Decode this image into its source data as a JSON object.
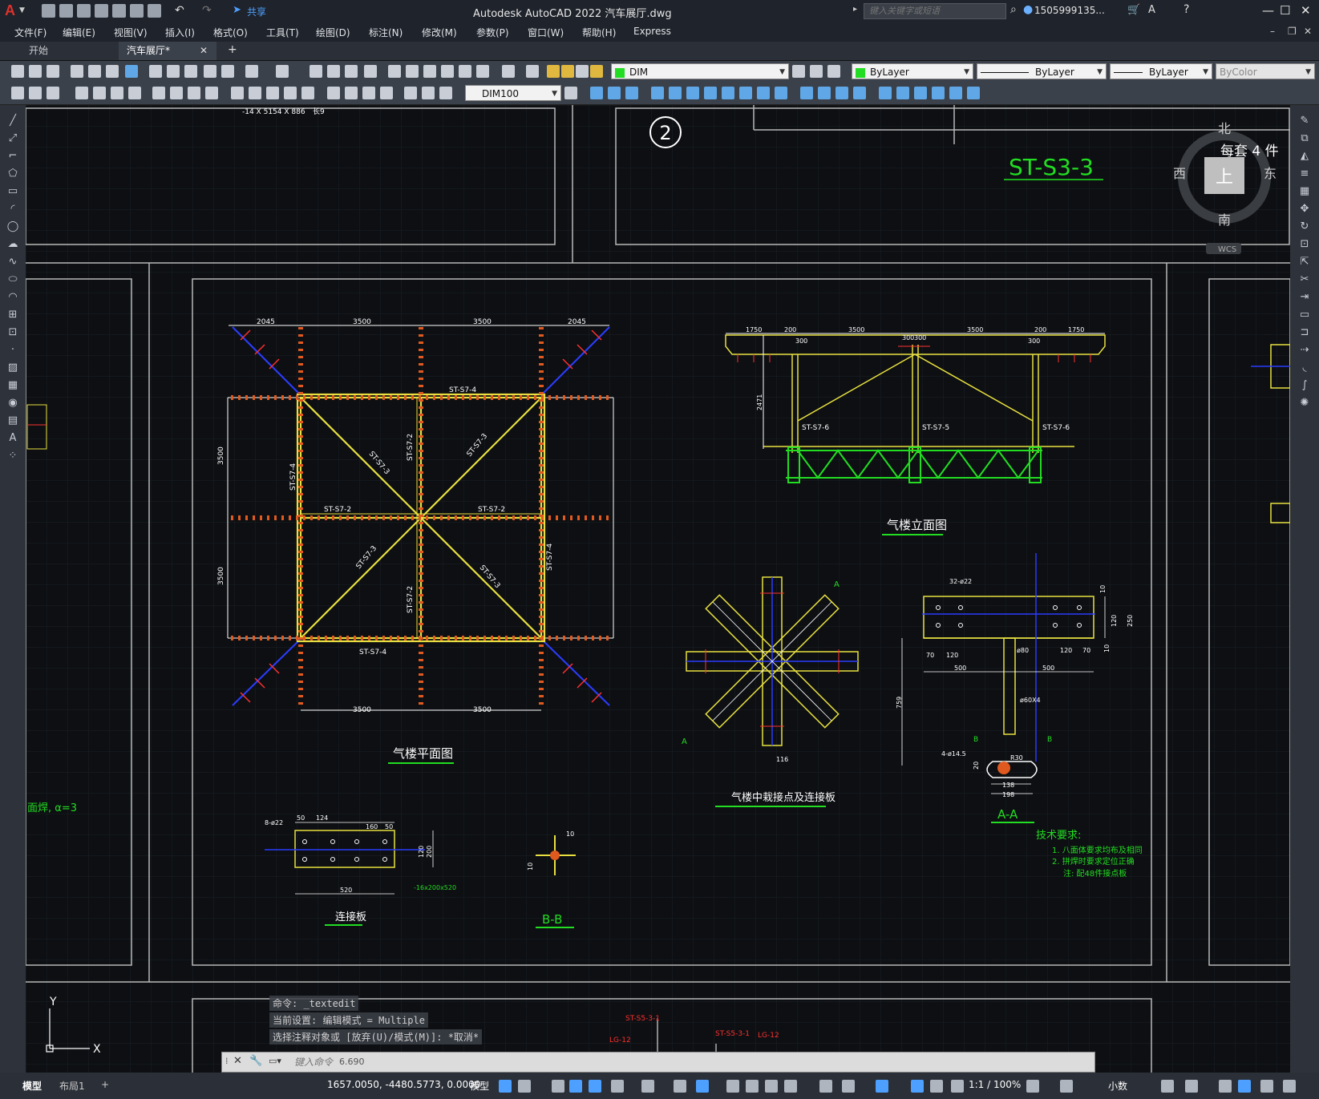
{
  "app": {
    "title": "Autodesk AutoCAD 2022    汽车展厅.dwg",
    "logo": "A",
    "share_label": "共享",
    "search_placeholder": "键入关键字或短语",
    "user": "1505999135...",
    "window_controls": [
      "minimize-icon",
      "maximize-icon",
      "close-icon"
    ]
  },
  "menubar": {
    "items": [
      "文件(F)",
      "编辑(E)",
      "视图(V)",
      "插入(I)",
      "格式(O)",
      "工具(T)",
      "绘图(D)",
      "标注(N)",
      "修改(M)",
      "参数(P)",
      "窗口(W)",
      "帮助(H)",
      "Express"
    ]
  },
  "tabs": {
    "start": "开始",
    "active": "汽车展厅*",
    "close": "✕",
    "add": "+"
  },
  "toolbar": {
    "layer": "DIM",
    "color": "ByLayer",
    "linetype": "ByLayer",
    "lineweight": "ByLayer",
    "plotstyle": "ByColor",
    "dimstyle": "DIM100"
  },
  "viewcube": {
    "north": "北",
    "south": "南",
    "east": "东",
    "west": "西",
    "top": "上",
    "wcs": "WCS",
    "note": "每套 4 件"
  },
  "drawing": {
    "sheet_number": "2",
    "sheet_title": "ST-S3-3",
    "plan_title": "气楼平面图",
    "elevation_title": "气楼立面图",
    "joint_title": "气楼中栽接点及连接板",
    "plate_title": "连接板",
    "section_bb": "B-B",
    "section_aa": "A-A",
    "tech_title": "技术要求:",
    "tech_notes": [
      "1. 八面体要求均布及相同",
      "2. 拼焊时要求定位正确",
      "注: 配48件接点板"
    ],
    "top_dim": "-14 X 5154 X 886",
    "top_dim2": "长9",
    "side_note": "面焊, α=3",
    "plan_dims_top": [
      "2045",
      "3500",
      "3500",
      "2045"
    ],
    "plan_dims_bottom": [
      "3500",
      "3500"
    ],
    "plan_dims_side": [
      "3500",
      "3500"
    ],
    "plan_members": [
      "ST-S7-4",
      "ST-S7-2",
      "ST-S7-3",
      "ST-S7-2",
      "ST-S7-2",
      "ST-S7-3",
      "ST-S7-4",
      "ST-S7-3",
      "ST-S7-2",
      "ST-S7-3",
      "ST-S7-4",
      "ST-S7-4"
    ],
    "elev_dims": [
      "1750",
      "200",
      "3500",
      "300",
      "300",
      "3500",
      "200",
      "1750",
      "300",
      "300"
    ],
    "elev_members": [
      "ST-S7-6",
      "ST-S7-5",
      "ST-S7-6"
    ],
    "elev_height": "2471",
    "aa_dims": [
      "32-ø22",
      "70",
      "120",
      "ø80",
      "120",
      "70",
      "500",
      "500",
      "ø60X4",
      "759",
      "4-ø14.5",
      "R30",
      "138",
      "198",
      "250",
      "120",
      "10",
      "10",
      "20"
    ],
    "plate_dims": [
      "8-ø22",
      "50",
      "124",
      "160",
      "50",
      "520",
      "200",
      "120",
      "-16x200x520"
    ],
    "bb_dims": [
      "10",
      "10"
    ],
    "labels_bottom": [
      "ST-S5-3-1",
      "LG-12",
      "ST-S5-3-1",
      "LG-12"
    ]
  },
  "command": {
    "history": [
      "命令: _textedit",
      "当前设置: 编辑模式 = Multiple",
      "选择注释对象或 [放弃(U)/模式(M)]: *取消*"
    ],
    "placeholder": "键入命令",
    "value_hint": "6.690"
  },
  "ucs": {
    "x": "X",
    "y": "Y"
  },
  "status": {
    "model_tab": "模型",
    "layout_tab": "布局1",
    "add": "+",
    "coords": "1657.0050, -4480.5773, 0.0000",
    "mode": "模型",
    "scale": "1:1 / 100%",
    "units": "小数"
  },
  "colors": {
    "canvas": "#0d0f12",
    "grid": "#1c2128",
    "member": "#e8e040",
    "dim": "#ffffff",
    "green": "#22dd22",
    "red": "#ff3030",
    "blue": "#2b3cff"
  }
}
